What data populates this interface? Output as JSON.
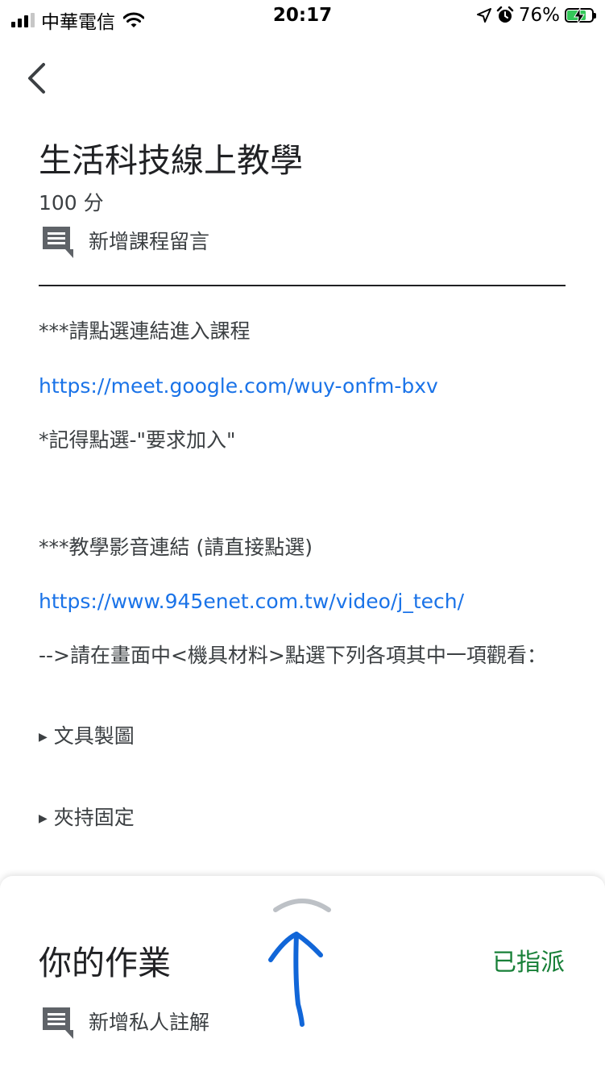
{
  "status_bar": {
    "carrier": "中華電信",
    "time": "20:17",
    "battery": "76%"
  },
  "assignment": {
    "title": "生活科技線上教學",
    "points": "100 分",
    "class_comment": "新增課程留言"
  },
  "body": {
    "line1": "***請點選連結進入課程",
    "link1": "https://meet.google.com/wuy-onfm-bxv",
    "line2": "*記得點選-\"要求加入\"",
    "line3": "***教學影音連結 (請直接點選)",
    "link2": "https://www.945enet.com.tw/video/j_tech/",
    "line4": "-->請在畫面中<機具材料>點選下列各項其中一項觀看：",
    "items": [
      "文具製圖",
      "夾持固定"
    ]
  },
  "sheet": {
    "title": "你的作業",
    "status": "已指派",
    "private_comment": "新增私人註解"
  },
  "colors": {
    "link": "#1a73e8",
    "assigned": "#188038",
    "text": "#3c4043"
  },
  "icons": [
    "back-arrow-icon",
    "comment-icon",
    "handle-chevron-icon",
    "hand-drawn-arrow-icon"
  ]
}
